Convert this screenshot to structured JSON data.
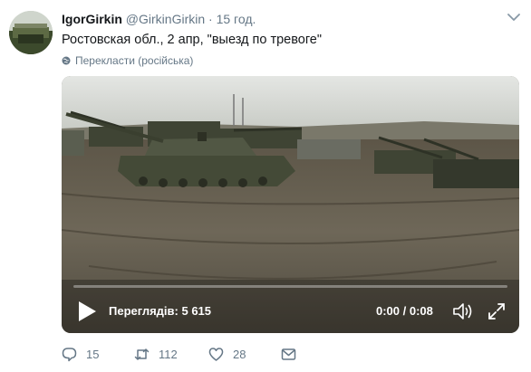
{
  "tweet": {
    "author_name": "IgorGirkin",
    "handle": "@GirkinGirkin",
    "separator": "·",
    "time": "15 год.",
    "text": "Ростовская обл., 2 апр, \"выезд по тревоге\"",
    "translate_label": "Перекласти (російська)"
  },
  "video": {
    "views_label": "Переглядів: 5 615",
    "duration_label": "0:00 / 0:08",
    "progress": 0
  },
  "actions": {
    "replies": "15",
    "retweets": "112",
    "likes": "28"
  },
  "icons": {
    "avatar": "avatar-image",
    "menu": "chevron-down-icon",
    "translate": "globe-icon",
    "play": "play-icon",
    "volume": "volume-icon",
    "fullscreen": "fullscreen-icon",
    "reply": "reply-icon",
    "retweet": "retweet-icon",
    "like": "heart-icon",
    "dm": "envelope-icon"
  },
  "colors": {
    "text": "#14171a",
    "muted": "#657786",
    "video_overlay": "#ffffff"
  }
}
